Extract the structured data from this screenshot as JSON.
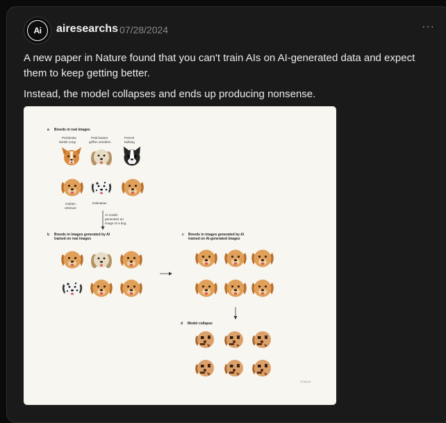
{
  "post": {
    "author": "airesearchs",
    "date": "07/28/2024",
    "avatar_text": "Ai",
    "more_label": "···",
    "paragraphs": [
      "A new paper in Nature found that you can't train AIs on AI-generated data and expect them to keep getting better.",
      "Instead, the model collapses and ends up producing nonsense."
    ]
  },
  "figure": {
    "panel_a": {
      "letter": "a",
      "title": "Breeds in real images",
      "breeds": [
        "Pembroke",
        "Welsh corgi",
        "Petit basset",
        "griffon vendéen",
        "French",
        "bulldog",
        "Golden",
        "retriever",
        "Dalmatian"
      ]
    },
    "arrow_note": [
      "AI model",
      "generates an",
      "image of a dog"
    ],
    "panel_b": {
      "letter": "b",
      "title": [
        "Breeds in images generated by AI",
        "trained on real images"
      ]
    },
    "panel_c": {
      "letter": "c",
      "title": [
        "Breeds in images generated by AI",
        "trained on AI-generated images"
      ]
    },
    "panel_d": {
      "letter": "d",
      "title": "Model collapse"
    },
    "credit": "©nature"
  }
}
